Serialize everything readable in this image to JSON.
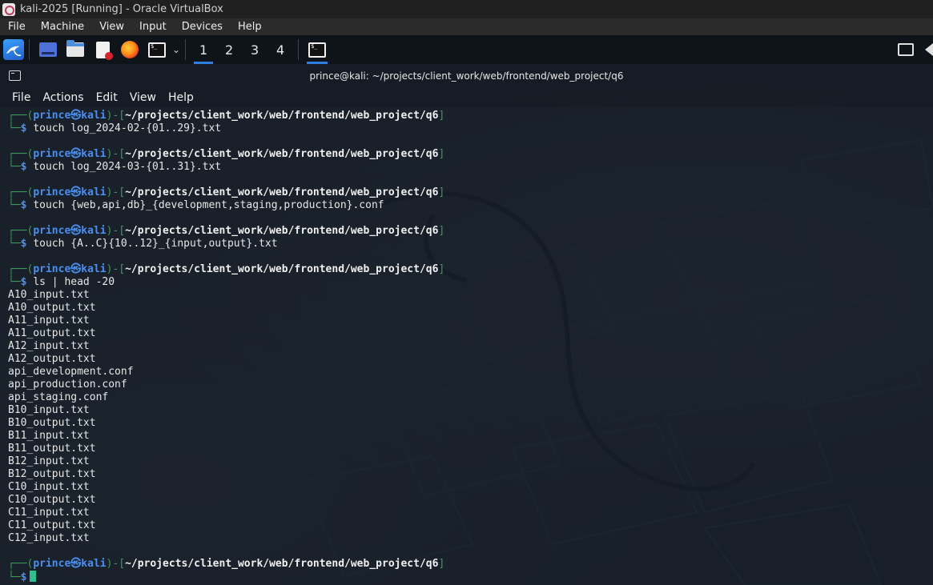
{
  "vbox": {
    "title": "kali-2025 [Running] - Oracle VirtualBox",
    "menu": [
      "File",
      "Machine",
      "View",
      "Input",
      "Devices",
      "Help"
    ]
  },
  "panel": {
    "workspaces": [
      "1",
      "2",
      "3",
      "4"
    ],
    "active_workspace": "1",
    "icons": [
      "kali-menu-icon",
      "show-desktop-icon",
      "file-manager-icon",
      "text-editor-icon",
      "firefox-icon",
      "terminal-icon"
    ]
  },
  "terminal": {
    "title": "prince@kali: ~/projects/client_work/web/frontend/web_project/q6",
    "menu": [
      "File",
      "Actions",
      "Edit",
      "View",
      "Help"
    ],
    "prompt": {
      "corner_top": "┌──(",
      "user": "prince",
      "at": "㉿",
      "host": "kali",
      "mid": ")-[",
      "path": "~/projects/client_work/web/frontend/web_project/q6",
      "end": "]",
      "corner_bottom": "└─",
      "dollar": "$"
    },
    "commands": [
      "touch log_2024-02-{01..29}.txt",
      "touch log_2024-03-{01..31}.txt",
      "touch {web,api,db}_{development,staging,production}.conf",
      "touch {A..C}{10..12}_{input,output}.txt",
      "ls | head -20"
    ],
    "ls_output": [
      "A10_input.txt",
      "A10_output.txt",
      "A11_input.txt",
      "A11_output.txt",
      "A12_input.txt",
      "A12_output.txt",
      "api_development.conf",
      "api_production.conf",
      "api_staging.conf",
      "B10_input.txt",
      "B10_output.txt",
      "B11_input.txt",
      "B11_output.txt",
      "B12_input.txt",
      "B12_output.txt",
      "C10_input.txt",
      "C10_output.txt",
      "C11_input.txt",
      "C11_output.txt",
      "C12_input.txt"
    ]
  },
  "colors": {
    "prompt_green": "#3d9a5a",
    "prompt_blue": "#4a8ff0",
    "cursor": "#2fbf8f"
  }
}
